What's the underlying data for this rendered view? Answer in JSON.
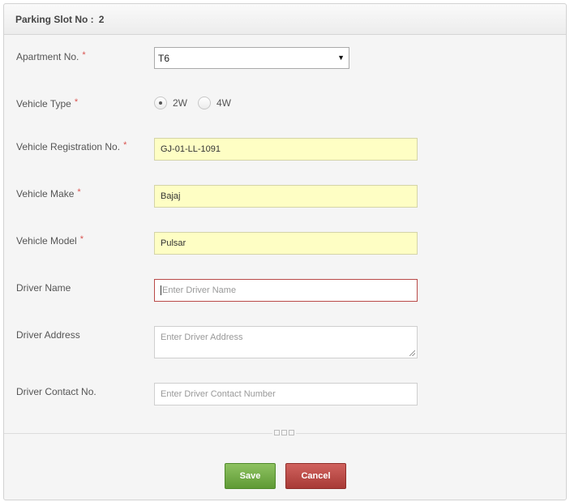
{
  "header": {
    "slot_label": "Parking Slot No :",
    "slot_value": "2"
  },
  "form": {
    "apartment": {
      "label": "Apartment No.",
      "required": "*",
      "selected": "T6"
    },
    "vehicle_type": {
      "label": "Vehicle Type",
      "required": "*",
      "options": [
        "2W",
        "4W"
      ],
      "selected": "2W"
    },
    "registration": {
      "label": "Vehicle Registration No.",
      "required": "*",
      "value": "GJ-01-LL-1091"
    },
    "make": {
      "label": "Vehicle Make",
      "required": "*",
      "value": "Bajaj"
    },
    "model": {
      "label": "Vehicle Model",
      "required": "*",
      "value": "Pulsar"
    },
    "driver_name": {
      "label": "Driver Name",
      "placeholder": "Enter Driver Name"
    },
    "driver_address": {
      "label": "Driver Address",
      "placeholder": "Enter Driver Address"
    },
    "driver_contact": {
      "label": "Driver Contact No.",
      "placeholder": "Enter Driver Contact Number"
    }
  },
  "actions": {
    "save_label": "Save",
    "cancel_label": "Cancel"
  },
  "colors": {
    "save": "#6aa83e",
    "cancel": "#b8443f",
    "required": "#d9534f",
    "filled_bg": "#fefec4",
    "focus_border": "#b94a48"
  },
  "icons": {
    "select_caret": "triangle-down-icon",
    "separator": "dots-icon"
  }
}
